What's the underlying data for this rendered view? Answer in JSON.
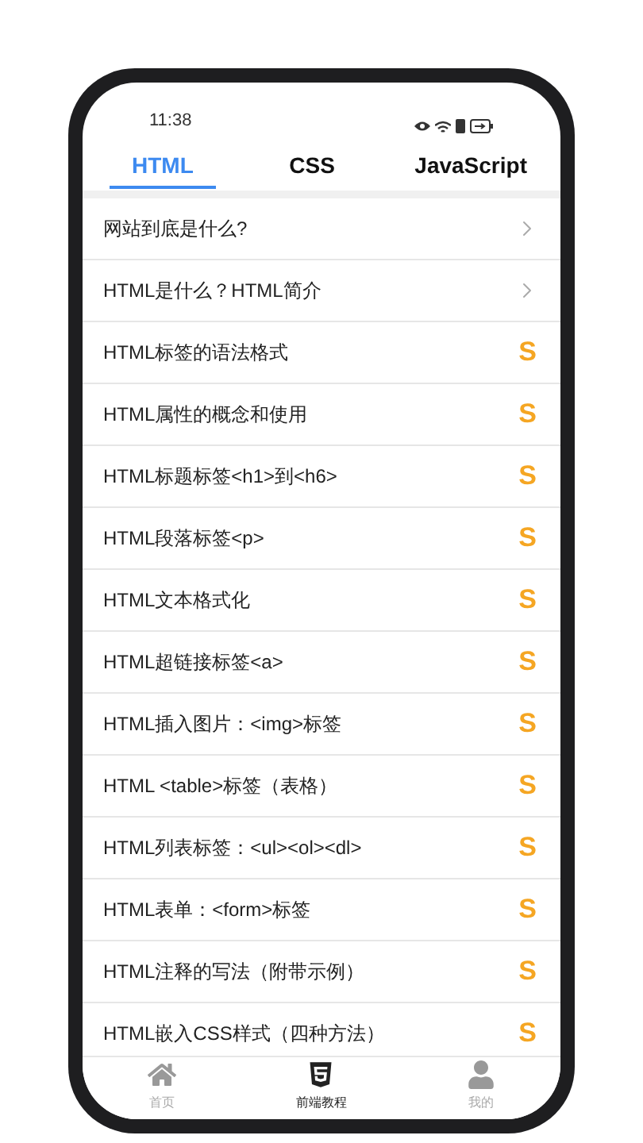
{
  "status_bar": {
    "time": "11:38"
  },
  "tabs": [
    {
      "label": "HTML",
      "selected": true
    },
    {
      "label": "CSS",
      "selected": false
    },
    {
      "label": "JavaScript",
      "selected": false
    }
  ],
  "lessons": [
    {
      "title": "网站到底是什么?",
      "kind": "open"
    },
    {
      "title": "HTML是什么？HTML简介",
      "kind": "open"
    },
    {
      "title": "HTML标签的语法格式",
      "kind": "paid",
      "badge": "S"
    },
    {
      "title": "HTML属性的概念和使用",
      "kind": "paid",
      "badge": "S"
    },
    {
      "title": "HTML标题标签<h1>到<h6>",
      "kind": "paid",
      "badge": "S"
    },
    {
      "title": "HTML段落标签<p>",
      "kind": "paid",
      "badge": "S"
    },
    {
      "title": "HTML文本格式化",
      "kind": "paid",
      "badge": "S"
    },
    {
      "title": "HTML超链接标签<a>",
      "kind": "paid",
      "badge": "S"
    },
    {
      "title": "HTML插入图片：<img>标签",
      "kind": "paid",
      "badge": "S"
    },
    {
      "title": "HTML <table>标签（表格）",
      "kind": "paid",
      "badge": "S"
    },
    {
      "title": "HTML列表标签：<ul><ol><dl>",
      "kind": "paid",
      "badge": "S"
    },
    {
      "title": "HTML表单：<form>标签",
      "kind": "paid",
      "badge": "S"
    },
    {
      "title": "HTML注释的写法（附带示例）",
      "kind": "paid",
      "badge": "S"
    },
    {
      "title": "HTML嵌入CSS样式（四种方法）",
      "kind": "paid",
      "badge": "S"
    }
  ],
  "bottom_nav": [
    {
      "label": "首页",
      "kind": "home",
      "selected": false
    },
    {
      "label": "前端教程",
      "kind": "html5",
      "selected": true
    },
    {
      "label": "我的",
      "kind": "user",
      "selected": false
    }
  ]
}
